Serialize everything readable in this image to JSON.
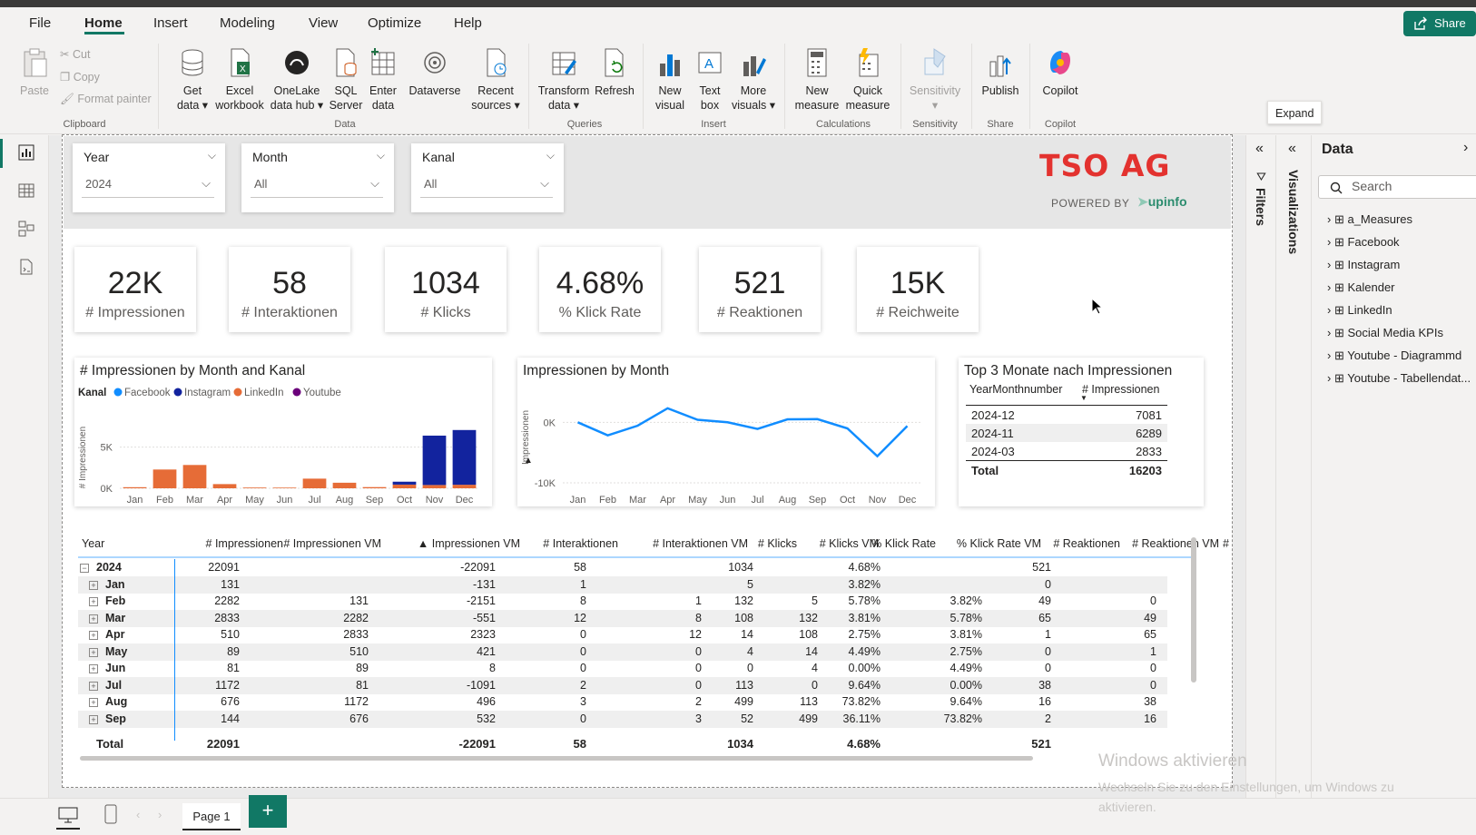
{
  "menu": {
    "items": [
      "File",
      "Home",
      "Insert",
      "Modeling",
      "View",
      "Optimize",
      "Help"
    ],
    "active": "Home",
    "share": "Share"
  },
  "ribbon": {
    "clipboard": {
      "paste": "Paste",
      "cut": "Cut",
      "copy": "Copy",
      "format_painter": "Format painter",
      "group": "Clipboard"
    },
    "data": {
      "get_data": [
        "Get",
        "data ▾"
      ],
      "excel": [
        "Excel",
        "workbook"
      ],
      "onelake": [
        "OneLake",
        "data hub ▾"
      ],
      "sql": [
        "SQL",
        "Server"
      ],
      "enter": [
        "Enter",
        "data"
      ],
      "dataverse": [
        "Dataverse",
        ""
      ],
      "recent": [
        "Recent",
        "sources ▾"
      ],
      "group": "Data"
    },
    "queries": {
      "transform": [
        "Transform",
        "data ▾"
      ],
      "refresh": [
        "Refresh",
        ""
      ],
      "group": "Queries"
    },
    "insert": {
      "new_visual": [
        "New",
        "visual"
      ],
      "text_box": [
        "Text",
        "box"
      ],
      "more_visuals": [
        "More",
        "visuals ▾"
      ],
      "group": "Insert"
    },
    "calculations": {
      "new_measure": [
        "New",
        "measure"
      ],
      "quick_measure": [
        "Quick",
        "measure"
      ],
      "group": "Calculations"
    },
    "sensitivity": {
      "label": [
        "Sensitivity",
        "▾"
      ],
      "group": "Sensitivity"
    },
    "share": {
      "publish": [
        "Publish",
        ""
      ],
      "group": "Share"
    },
    "copilot": {
      "label": [
        "Copilot",
        ""
      ],
      "group": "Copilot"
    }
  },
  "tooltip": "Expand",
  "slicers": [
    {
      "title": "Year",
      "value": "2024"
    },
    {
      "title": "Month",
      "value": "All"
    },
    {
      "title": "Kanal",
      "value": "All"
    }
  ],
  "logo": {
    "name": "TSO AG",
    "powered": "POWERED BY",
    "partner": "upinfo"
  },
  "cards": [
    {
      "value": "22K",
      "label": "# Impressionen"
    },
    {
      "value": "58",
      "label": "# Interaktionen"
    },
    {
      "value": "1034",
      "label": "# Klicks"
    },
    {
      "value": "4.68%",
      "label": "% Klick Rate"
    },
    {
      "value": "521",
      "label": "# Reaktionen"
    },
    {
      "value": "15K",
      "label": "# Reichweite"
    }
  ],
  "chart_data": [
    {
      "type": "bar",
      "stacked": true,
      "title": "# Impressionen by Month and Kanal",
      "legend_title": "Kanal",
      "legend_placement": "top-left",
      "ylabel": "# Impressionen",
      "yticks": [
        "0K",
        "5K"
      ],
      "ylim": [
        0,
        7500
      ],
      "categories": [
        "Jan",
        "Feb",
        "Mar",
        "Apr",
        "May",
        "Jun",
        "Jul",
        "Aug",
        "Sep",
        "Oct",
        "Nov",
        "Dec"
      ],
      "series": [
        {
          "name": "Facebook",
          "color": "#118dff",
          "values": [
            0,
            0,
            0,
            0,
            0,
            0,
            0,
            0,
            0,
            0,
            0,
            0
          ]
        },
        {
          "name": "Instagram",
          "color": "#12239e",
          "values": [
            0,
            0,
            0,
            0,
            0,
            0,
            0,
            0,
            0,
            350,
            6000,
            6650
          ]
        },
        {
          "name": "LinkedIn",
          "color": "#e66c37",
          "values": [
            131,
            2282,
            2833,
            510,
            89,
            81,
            1172,
            676,
            144,
            450,
            400,
            431
          ]
        },
        {
          "name": "Youtube",
          "color": "#6b007b",
          "values": [
            0,
            0,
            0,
            0,
            0,
            0,
            0,
            0,
            0,
            0,
            0,
            0
          ]
        }
      ]
    },
    {
      "type": "line",
      "title": "Impressionen by Month",
      "ylabel": "Impressionen",
      "yticks": [
        "0K",
        "-10K"
      ],
      "ylim": [
        -10000,
        2000
      ],
      "categories": [
        "Jan",
        "Feb",
        "Mar",
        "Apr",
        "May",
        "Jun",
        "Jul",
        "Aug",
        "Sep",
        "Oct",
        "Nov",
        "Dec"
      ],
      "series": [
        {
          "color": "#118dff",
          "values": [
            0,
            -2151,
            -551,
            2323,
            421,
            8,
            -1091,
            496,
            532,
            -1000,
            -5600,
            -600
          ]
        }
      ]
    }
  ],
  "top3": {
    "title": "Top 3 Monate nach Impressionen",
    "headers": [
      "YearMonthnumber",
      "# Impressionen"
    ],
    "rows": [
      [
        "2024-12",
        "7081"
      ],
      [
        "2024-11",
        "6289"
      ],
      [
        "2024-03",
        "2833"
      ]
    ],
    "total": [
      "Total",
      "16203"
    ]
  },
  "matrix": {
    "headers": [
      "Year",
      "# Impressionen",
      "# Impressionen VM",
      "▲ Impressionen VM",
      "# Interaktionen",
      "# Interaktionen VM",
      "# Klicks",
      "# Klicks VM",
      "% Klick Rate",
      "% Klick Rate VM",
      "# Reaktionen",
      "# Reaktionen VM",
      "#"
    ],
    "rows": [
      {
        "label": "2024",
        "exp": "⊟",
        "cells": [
          "22091",
          "",
          "-22091",
          "58",
          "",
          "1034",
          "",
          "4.68%",
          "",
          "521",
          ""
        ]
      },
      {
        "label": "Jan",
        "exp": "⊞",
        "cells": [
          "131",
          "",
          "-131",
          "1",
          "",
          "5",
          "",
          "3.82%",
          "",
          "0",
          ""
        ]
      },
      {
        "label": "Feb",
        "exp": "⊞",
        "cells": [
          "2282",
          "131",
          "-2151",
          "8",
          "1",
          "132",
          "5",
          "5.78%",
          "3.82%",
          "49",
          "0"
        ]
      },
      {
        "label": "Mar",
        "exp": "⊞",
        "cells": [
          "2833",
          "2282",
          "-551",
          "12",
          "8",
          "108",
          "132",
          "3.81%",
          "5.78%",
          "65",
          "49"
        ]
      },
      {
        "label": "Apr",
        "exp": "⊞",
        "cells": [
          "510",
          "2833",
          "2323",
          "0",
          "12",
          "14",
          "108",
          "2.75%",
          "3.81%",
          "1",
          "65"
        ]
      },
      {
        "label": "May",
        "exp": "⊞",
        "cells": [
          "89",
          "510",
          "421",
          "0",
          "0",
          "4",
          "14",
          "4.49%",
          "2.75%",
          "0",
          "1"
        ]
      },
      {
        "label": "Jun",
        "exp": "⊞",
        "cells": [
          "81",
          "89",
          "8",
          "0",
          "0",
          "0",
          "4",
          "0.00%",
          "4.49%",
          "0",
          "0"
        ]
      },
      {
        "label": "Jul",
        "exp": "⊞",
        "cells": [
          "1172",
          "81",
          "-1091",
          "2",
          "0",
          "113",
          "0",
          "9.64%",
          "0.00%",
          "38",
          "0"
        ]
      },
      {
        "label": "Aug",
        "exp": "⊞",
        "cells": [
          "676",
          "1172",
          "496",
          "3",
          "2",
          "499",
          "113",
          "73.82%",
          "9.64%",
          "16",
          "38"
        ]
      },
      {
        "label": "Sep",
        "exp": "⊞",
        "cells": [
          "144",
          "676",
          "532",
          "0",
          "3",
          "52",
          "499",
          "36.11%",
          "73.82%",
          "2",
          "16"
        ]
      }
    ],
    "total": {
      "label": "Total",
      "cells": [
        "22091",
        "",
        "-22091",
        "58",
        "",
        "1034",
        "",
        "4.68%",
        "",
        "521",
        ""
      ]
    }
  },
  "panes": {
    "filters": "Filters",
    "visualizations": "Visualizations",
    "data": "Data",
    "search_placeholder": "Search",
    "tables": [
      "a_Measures",
      "Facebook",
      "Instagram",
      "Kalender",
      "LinkedIn",
      "Social Media KPIs",
      "Youtube - Diagrammd",
      "Youtube - Tabellendat..."
    ]
  },
  "pages": {
    "tab": "Page 1",
    "add": "+"
  },
  "watermark": {
    "title": "Windows aktivieren",
    "text": "Wechseln Sie zu den Einstellungen, um Windows zu aktivieren."
  }
}
